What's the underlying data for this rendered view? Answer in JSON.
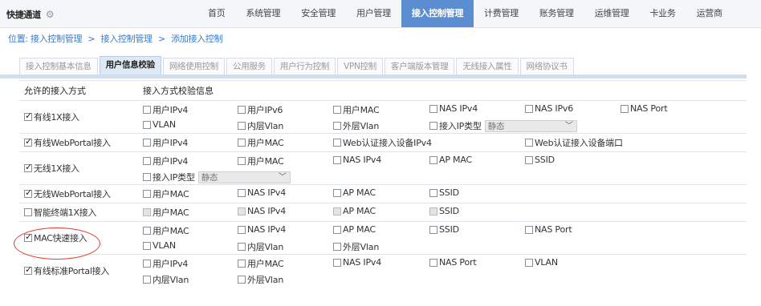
{
  "topbar": {
    "quick_access": "快捷通道",
    "gear_icon": "gear-icon",
    "nav": [
      {
        "label": "首页",
        "active": false
      },
      {
        "label": "系统管理",
        "active": false
      },
      {
        "label": "安全管理",
        "active": false
      },
      {
        "label": "用户管理",
        "active": false
      },
      {
        "label": "接入控制管理",
        "active": true
      },
      {
        "label": "计费管理",
        "active": false
      },
      {
        "label": "账务管理",
        "active": false
      },
      {
        "label": "运维管理",
        "active": false
      },
      {
        "label": "卡业务",
        "active": false
      },
      {
        "label": "运营商",
        "active": false
      }
    ]
  },
  "breadcrumb": {
    "prefix": "位置:",
    "items": [
      "接入控制管理",
      "接入控制管理",
      "添加接入控制"
    ],
    "separator": ">"
  },
  "tabs": [
    {
      "label": "接入控制基本信息",
      "active": false
    },
    {
      "label": "用户信息校验",
      "active": true
    },
    {
      "label": "网络使用控制",
      "active": false
    },
    {
      "label": "公用服务",
      "active": false
    },
    {
      "label": "用户行为控制",
      "active": false
    },
    {
      "label": "VPN控制",
      "active": false
    },
    {
      "label": "客户端版本管理",
      "active": false
    },
    {
      "label": "无线接入属性",
      "active": false
    },
    {
      "label": "网络协议书",
      "active": false
    }
  ],
  "table": {
    "header_left": "允许的接入方式",
    "header_right": "接入方式校验信息",
    "select_value": "静态",
    "rows": [
      {
        "label": "有线1X接入",
        "checked": true,
        "lines": [
          [
            "用户IPv4",
            "用户IPv6",
            "用户MAC",
            "NAS IPv4",
            "NAS IPv6",
            "NAS Port"
          ],
          [
            "VLAN",
            "内层Vlan",
            "外层Vlan",
            "接入IP类型"
          ]
        ]
      },
      {
        "label": "有线WebPortal接入",
        "checked": true,
        "lines": [
          [
            "用户IPv4",
            "用户MAC",
            "Web认证接入设备IPv4",
            "Web认证接入设备端口"
          ]
        ]
      },
      {
        "label": "无线1X接入",
        "checked": true,
        "lines": [
          [
            "用户IPv4",
            "用户MAC",
            "NAS IPv4",
            "AP MAC",
            "SSID"
          ],
          [
            "接入IP类型"
          ]
        ]
      },
      {
        "label": "无线WebPortal接入",
        "checked": true,
        "lines": [
          [
            "用户MAC",
            "NAS IPv4",
            "AP MAC",
            "SSID"
          ]
        ]
      },
      {
        "label": "智能终端1X接入",
        "checked": false,
        "lines": [
          [
            "用户MAC",
            "NAS IPv4",
            "AP MAC",
            "SSID"
          ]
        ]
      },
      {
        "label": "MAC快速接入",
        "checked": true,
        "lines": [
          [
            "用户MAC",
            "NAS IPv4",
            "AP MAC",
            "SSID",
            "NAS Port"
          ],
          [
            "VLAN",
            "内层Vlan",
            "外层Vlan"
          ]
        ]
      },
      {
        "label": "有线标准Portal接入",
        "checked": true,
        "lines": [
          [
            "用户IPv4",
            "用户MAC",
            "NAS IPv4",
            "NAS Port",
            "VLAN"
          ],
          [
            "内层Vlan",
            "外层Vlan"
          ]
        ]
      }
    ]
  },
  "colors": {
    "nav_active": "#5b8ed0",
    "link": "#3a7bc8",
    "highlight": "#e23a2b"
  }
}
